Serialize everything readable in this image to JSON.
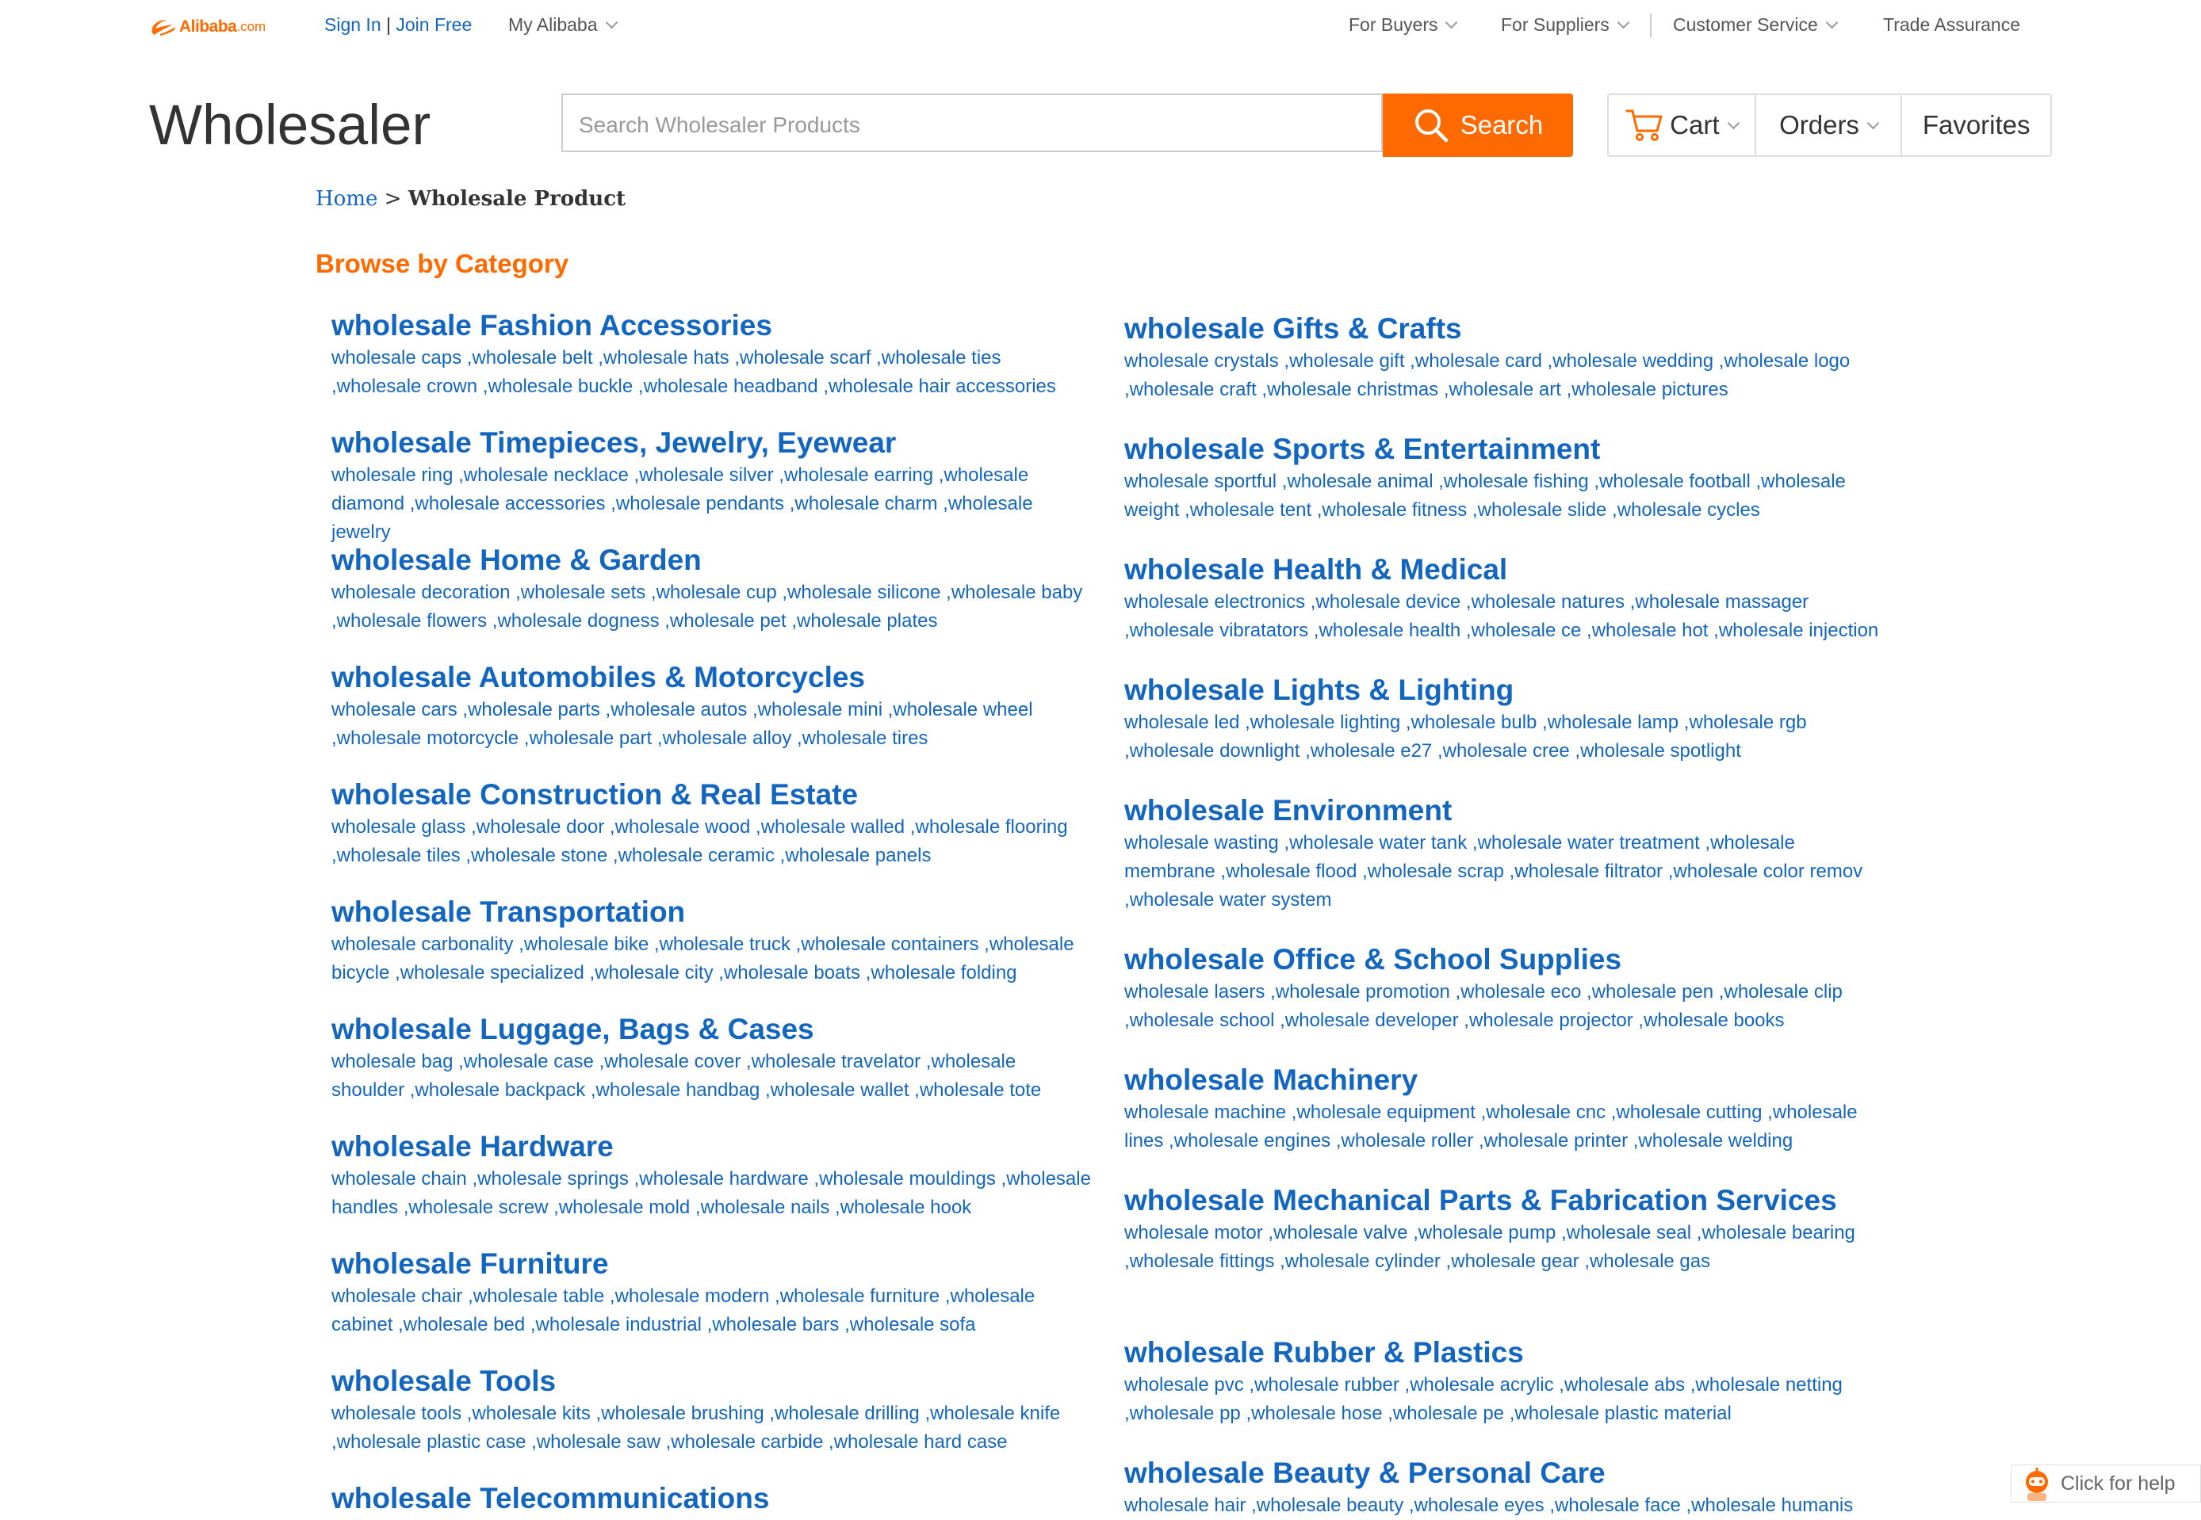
{
  "header": {
    "logo_text": "Alibaba",
    "logo_suffix": ".com",
    "sign_in": "Sign In",
    "separator": "|",
    "join_free": "Join Free",
    "my_alibaba": "My Alibaba",
    "for_buyers": "For Buyers",
    "for_suppliers": "For Suppliers",
    "customer_service": "Customer Service",
    "trade_assurance": "Trade Assurance"
  },
  "main_header": {
    "site_title": "Wholesaler",
    "search_placeholder": "Search Wholesaler Products",
    "search_button": "Search",
    "cart": "Cart",
    "orders": "Orders",
    "favorites": "Favorites"
  },
  "breadcrumb": {
    "home": "Home",
    "separator": ">",
    "current": "Wholesale Product"
  },
  "browse_title": "Browse by Category",
  "categories_left": [
    {
      "title": "wholesale Fashion Accessories",
      "items": [
        "wholesale caps",
        "wholesale belt",
        "wholesale hats",
        "wholesale scarf",
        "wholesale ties",
        "wholesale crown",
        "wholesale buckle",
        "wholesale headband",
        "wholesale hair accessories"
      ]
    },
    {
      "title": "wholesale Timepieces, Jewelry, Eyewear",
      "items": [
        "wholesale ring",
        "wholesale necklace",
        "wholesale silver",
        "wholesale earring",
        "wholesale diamond",
        "wholesale accessories",
        "wholesale pendants",
        "wholesale charm",
        "wholesale jewelry"
      ]
    },
    {
      "title": "wholesale Home & Garden",
      "items": [
        "wholesale decoration",
        "wholesale sets",
        "wholesale cup",
        "wholesale silicone",
        "wholesale baby",
        "wholesale flowers",
        "wholesale dogness",
        "wholesale pet",
        "wholesale plates"
      ]
    },
    {
      "title": "wholesale Automobiles & Motorcycles",
      "items": [
        "wholesale cars",
        "wholesale parts",
        "wholesale autos",
        "wholesale mini",
        "wholesale wheel",
        "wholesale motorcycle",
        "wholesale part",
        "wholesale alloy",
        "wholesale tires"
      ]
    },
    {
      "title": "wholesale Construction & Real Estate",
      "items": [
        "wholesale glass",
        "wholesale door",
        "wholesale wood",
        "wholesale walled",
        "wholesale flooring",
        "wholesale tiles",
        "wholesale stone",
        "wholesale ceramic",
        "wholesale panels"
      ]
    },
    {
      "title": "wholesale Transportation",
      "items": [
        "wholesale carbonality",
        "wholesale bike",
        "wholesale truck",
        "wholesale containers",
        "wholesale bicycle",
        "wholesale specialized",
        "wholesale city",
        "wholesale boats",
        "wholesale folding"
      ]
    },
    {
      "title": "wholesale Luggage, Bags & Cases",
      "items": [
        "wholesale bag",
        "wholesale case",
        "wholesale cover",
        "wholesale travelator",
        "wholesale shoulder",
        "wholesale backpack",
        "wholesale handbag",
        "wholesale wallet",
        "wholesale tote"
      ]
    },
    {
      "title": "wholesale Hardware",
      "items": [
        "wholesale chain",
        "wholesale springs",
        "wholesale hardware",
        "wholesale mouldings",
        "wholesale handles",
        "wholesale screw",
        "wholesale mold",
        "wholesale nails",
        "wholesale hook"
      ]
    },
    {
      "title": "wholesale Furniture",
      "items": [
        "wholesale chair",
        "wholesale table",
        "wholesale modern",
        "wholesale furniture",
        "wholesale cabinet",
        "wholesale bed",
        "wholesale industrial",
        "wholesale bars",
        "wholesale sofa"
      ]
    },
    {
      "title": "wholesale Tools",
      "items": [
        "wholesale tools",
        "wholesale kits",
        "wholesale brushing",
        "wholesale drilling",
        "wholesale knife",
        "wholesale plastic case",
        "wholesale saw",
        "wholesale carbide",
        "wholesale hard case"
      ]
    },
    {
      "title": "wholesale Telecommunications",
      "items": []
    }
  ],
  "categories_right": [
    {
      "title": "wholesale Gifts & Crafts",
      "items": [
        "wholesale crystals",
        "wholesale gift",
        "wholesale card",
        "wholesale wedding",
        "wholesale logo",
        "wholesale craft",
        "wholesale christmas",
        "wholesale art",
        "wholesale pictures"
      ]
    },
    {
      "title": "wholesale Sports & Entertainment",
      "items": [
        "wholesale sportful",
        "wholesale animal",
        "wholesale fishing",
        "wholesale football",
        "wholesale weight",
        "wholesale tent",
        "wholesale fitness",
        "wholesale slide",
        "wholesale cycles"
      ]
    },
    {
      "title": "wholesale Health & Medical",
      "items": [
        "wholesale electronics",
        "wholesale device",
        "wholesale natures",
        "wholesale massager",
        "wholesale vibratators",
        "wholesale health",
        "wholesale ce",
        "wholesale hot",
        "wholesale injection"
      ]
    },
    {
      "title": "wholesale Lights & Lighting",
      "items": [
        "wholesale led",
        "wholesale lighting",
        "wholesale bulb",
        "wholesale lamp",
        "wholesale rgb",
        "wholesale downlight",
        "wholesale e27",
        "wholesale cree",
        "wholesale spotlight"
      ]
    },
    {
      "title": "wholesale Environment",
      "items": [
        "wholesale wasting",
        "wholesale water tank",
        "wholesale water treatment",
        "wholesale membrane",
        "wholesale flood",
        "wholesale scrap",
        "wholesale filtrator",
        "wholesale color remov",
        "wholesale water system"
      ]
    },
    {
      "title": "wholesale Office & School Supplies",
      "items": [
        "wholesale lasers",
        "wholesale promotion",
        "wholesale eco",
        "wholesale pen",
        "wholesale clip",
        "wholesale school",
        "wholesale developer",
        "wholesale projector",
        "wholesale books"
      ]
    },
    {
      "title": "wholesale Machinery",
      "items": [
        "wholesale machine",
        "wholesale equipment",
        "wholesale cnc",
        "wholesale cutting",
        "wholesale lines",
        "wholesale engines",
        "wholesale roller",
        "wholesale printer",
        "wholesale welding"
      ]
    },
    {
      "title": "wholesale Mechanical Parts & Fabrication Services",
      "items": [
        "wholesale motor",
        "wholesale valve",
        "wholesale pump",
        "wholesale seal",
        "wholesale bearing",
        "wholesale fittings",
        "wholesale cylinder",
        "wholesale gear",
        "wholesale gas"
      ]
    },
    {
      "title": "wholesale Rubber & Plastics",
      "items": [
        "wholesale pvc",
        "wholesale rubber",
        "wholesale acrylic",
        "wholesale abs",
        "wholesale netting",
        "wholesale pp",
        "wholesale hose",
        "wholesale pe",
        "wholesale plastic material"
      ]
    },
    {
      "title": "wholesale Beauty & Personal Care",
      "items": [
        "wholesale hair",
        "wholesale beauty",
        "wholesale eyes",
        "wholesale face",
        "wholesale humanis"
      ]
    }
  ],
  "help_widget": {
    "label": "Click for help"
  },
  "colors": {
    "brand_orange": "#ff6a00",
    "link_blue": "#1266c0"
  }
}
